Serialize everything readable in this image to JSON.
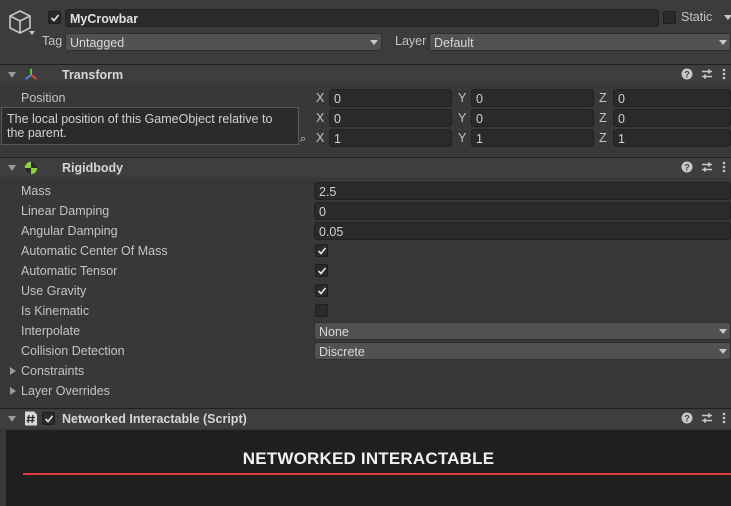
{
  "object": {
    "name": "MyCrowbar",
    "static_label": "Static",
    "tag_label": "Tag",
    "tag_value": "Untagged",
    "layer_label": "Layer",
    "layer_value": "Default"
  },
  "transform": {
    "title": "Transform",
    "position_label": "Position",
    "position": {
      "x": "0",
      "y": "0",
      "z": "0"
    },
    "rotation": {
      "x": "0",
      "y": "0",
      "z": "0"
    },
    "scale": {
      "x": "1",
      "y": "1",
      "z": "1"
    },
    "axis_x": "X",
    "axis_y": "Y",
    "axis_z": "Z",
    "tooltip": "The local position of this GameObject relative to the parent."
  },
  "rigidbody": {
    "title": "Rigidbody",
    "mass_label": "Mass",
    "mass": "2.5",
    "linear_damping_label": "Linear Damping",
    "linear_damping": "0",
    "angular_damping_label": "Angular Damping",
    "angular_damping": "0.05",
    "auto_com_label": "Automatic Center Of Mass",
    "auto_com": true,
    "auto_tensor_label": "Automatic Tensor",
    "auto_tensor": true,
    "use_gravity_label": "Use Gravity",
    "use_gravity": true,
    "is_kinematic_label": "Is Kinematic",
    "is_kinematic": false,
    "interpolate_label": "Interpolate",
    "interpolate": "None",
    "collision_label": "Collision Detection",
    "collision": "Discrete",
    "constraints_label": "Constraints",
    "layer_overrides_label": "Layer Overrides"
  },
  "script": {
    "title": "Networked Interactable (Script)",
    "banner": "NETWORKED INTERACTABLE",
    "accent_color": "#e0383b"
  }
}
